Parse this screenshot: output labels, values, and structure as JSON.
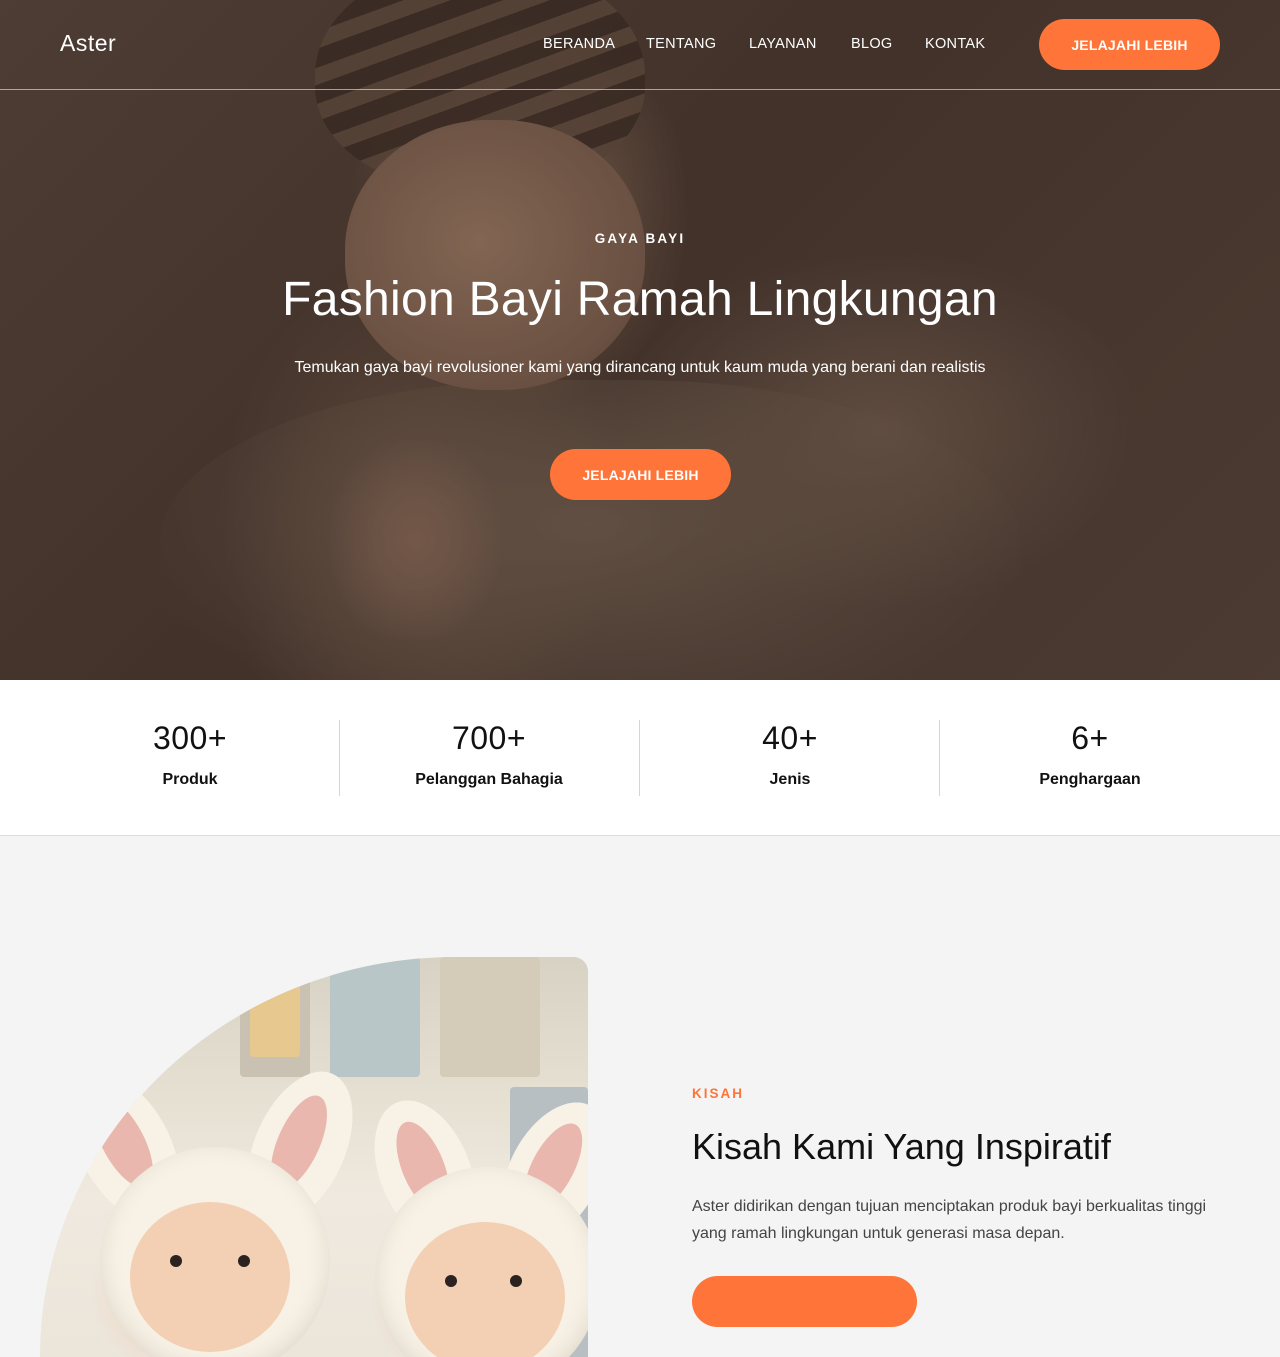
{
  "brand": {
    "logo": "Aster",
    "accent_color": "#ff7438"
  },
  "nav": {
    "items": [
      {
        "label": "BERANDA"
      },
      {
        "label": "TENTANG"
      },
      {
        "label": "LAYANAN"
      },
      {
        "label": "BLOG"
      },
      {
        "label": "KONTAK"
      }
    ],
    "cta_label": "JELAJAHI LEBIH"
  },
  "hero": {
    "kicker": "GAYA BAYI",
    "title": "Fashion Bayi Ramah Lingkungan",
    "subtitle": "Temukan gaya bayi revolusioner kami yang dirancang untuk kaum muda yang berani dan realistis",
    "cta_label": "JELAJAHI LEBIH"
  },
  "stats": [
    {
      "value": "300+",
      "label": "Produk"
    },
    {
      "value": "700+",
      "label": "Pelanggan Bahagia"
    },
    {
      "value": "40+",
      "label": "Jenis"
    },
    {
      "value": "6+",
      "label": "Penghargaan"
    }
  ],
  "story": {
    "kicker": "KISAH",
    "title": "Kisah Kami Yang Inspiratif",
    "text": "Aster didirikan dengan tujuan menciptakan produk bayi berkualitas tinggi yang ramah lingkungan untuk generasi masa depan."
  }
}
